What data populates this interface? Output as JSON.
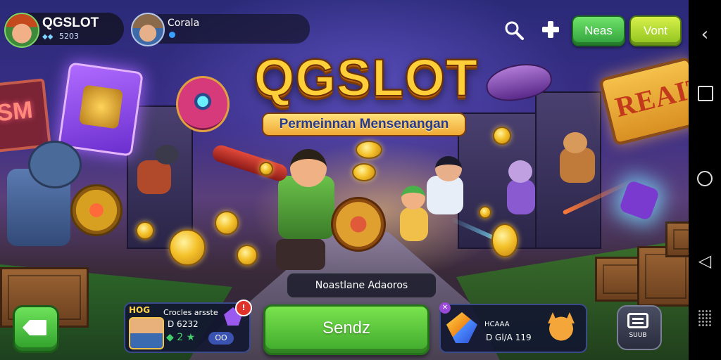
{
  "game": {
    "title": "QGSLOT",
    "subtitle": "Permeinnan Mensenangan"
  },
  "profile": {
    "name": "QGSLOT",
    "score": "5203",
    "score_icon": "diamond-icon"
  },
  "friend": {
    "name": "Corala"
  },
  "top_buttons": {
    "search_icon": "search-icon",
    "add_icon": "plus-icon",
    "news_label": "Neas",
    "vont_label": "Vont"
  },
  "scene_signs": {
    "left": "SM",
    "right": "REAIT"
  },
  "notice": {
    "text": "Noastlane Adaoros"
  },
  "left_panel": {
    "title": "HOG",
    "subtitle": "Crocles arsste",
    "value": "D 6232",
    "gems": "◆ 2 ★",
    "pill": "OO",
    "badge": "!"
  },
  "send_button": {
    "label": "Sendz"
  },
  "right_panel": {
    "line1": "HCAAA",
    "line2": "D Gl/A 119",
    "badge": "✕"
  },
  "chat_button": {
    "label": "SUUB"
  },
  "nav": {
    "back_icon": "‹",
    "home_icon": "home-icon",
    "back_tri": "◁"
  },
  "colors": {
    "title_gold": "#ffcf3a",
    "send_green": "#3ea82c",
    "news_green": "#2fa03a",
    "vont_lime": "#8ec21e"
  }
}
